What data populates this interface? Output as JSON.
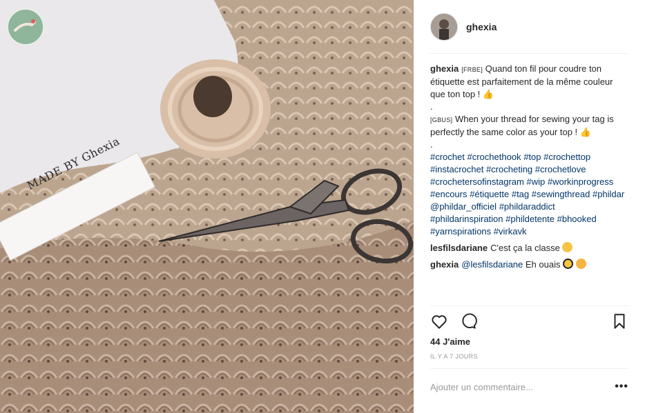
{
  "post": {
    "username": "ghexia",
    "label_text": "MADE BY Ghexia"
  },
  "caption": {
    "author": "ghexia",
    "fr_tag": "[FRBE]",
    "fr_text": "Quand ton fil pour coudre ton étiquette est parfaitement de la même couleur que ton top ! ",
    "dot1": ".",
    "en_tag": "[GBUS]",
    "en_text": "When your thread for sewing your tag is perfectly the same color as your top ! ",
    "dot2": ".",
    "thumb_emoji": "👍",
    "tags": [
      "#crochet",
      "#crochethook",
      "#top",
      "#crochettop",
      "#instacrochet",
      "#crocheting",
      "#crochetlove",
      "#crochetersofinstagram",
      "#wip",
      "#workinprogress",
      "#encours",
      "#étiquette",
      "#tag",
      "#sewingthread",
      "#phildar",
      "@phildar_officiel",
      "#phildaraddict",
      "#phildarinspiration",
      "#phildetente",
      "#bhooked",
      "#yarnspirations",
      "#virkavk"
    ]
  },
  "comments": [
    {
      "author": "lesfilsdariane",
      "text": "C'est ça la classe",
      "emoji": "wink-emoji"
    },
    {
      "author": "ghexia",
      "mention": "@lesfilsdariane",
      "text": "Eh ouais",
      "emoji": "sunglasses-emoji"
    }
  ],
  "actions": {
    "icons": [
      "heart-icon",
      "comment-icon",
      "bookmark-icon"
    ]
  },
  "likes": "44 J'aime",
  "time_ago": "IL Y A 7 JOURS",
  "add_comment": {
    "placeholder": "Ajouter un commentaire...",
    "more": "•••"
  },
  "colors": {
    "link": "#003569",
    "text": "#262626",
    "muted": "#999999",
    "divider": "#efefef"
  }
}
